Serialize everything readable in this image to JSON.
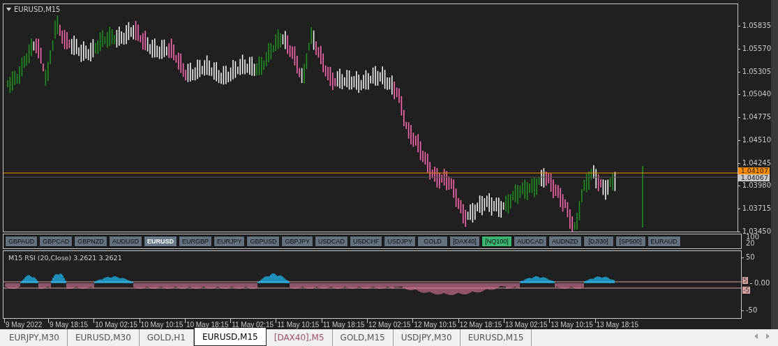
{
  "chart": {
    "title": "EURUSD,M15",
    "price_axis": [
      "1.05835",
      "1.05570",
      "1.05305",
      "1.05040",
      "1.04775",
      "1.04510",
      "1.04245",
      "1.03980",
      "1.03715",
      "1.03450"
    ],
    "bid_label": "1.04107",
    "ask_label": "1.04067"
  },
  "symbol_buttons": [
    {
      "label": "GBPAUD",
      "selected": false,
      "highlighted": false
    },
    {
      "label": "GBPCAD",
      "selected": false,
      "highlighted": false
    },
    {
      "label": "GBPNZD",
      "selected": false,
      "highlighted": false
    },
    {
      "label": "AUDUSD",
      "selected": false,
      "highlighted": false
    },
    {
      "label": "EURUSD",
      "selected": true,
      "highlighted": false
    },
    {
      "label": "EURGBP",
      "selected": false,
      "highlighted": false
    },
    {
      "label": "EURJPY",
      "selected": false,
      "highlighted": false
    },
    {
      "label": "GBPUSD",
      "selected": false,
      "highlighted": false
    },
    {
      "label": "GBPJPY",
      "selected": false,
      "highlighted": false
    },
    {
      "label": "USDCAD",
      "selected": false,
      "highlighted": false
    },
    {
      "label": "USDCHF",
      "selected": false,
      "highlighted": false
    },
    {
      "label": "USDJPY",
      "selected": false,
      "highlighted": false
    },
    {
      "label": "GOLD",
      "selected": false,
      "highlighted": false
    },
    {
      "label": "[DAX40]",
      "selected": false,
      "highlighted": false
    },
    {
      "label": "[NQ100]",
      "selected": false,
      "highlighted": true
    },
    {
      "label": "AUDCAD",
      "selected": false,
      "highlighted": false
    },
    {
      "label": "AUDNZD",
      "selected": false,
      "highlighted": false
    },
    {
      "label": "[DJI30]",
      "selected": false,
      "highlighted": false
    },
    {
      "label": "[SP500]",
      "selected": false,
      "highlighted": false
    },
    {
      "label": "EURAUD",
      "selected": false,
      "highlighted": false
    }
  ],
  "button_axis": [
    "100",
    "20"
  ],
  "rsi": {
    "title": "M15 RSI (20,Close) 3.2621 3.2621",
    "axis": [
      "50",
      "-50"
    ],
    "upper_level": "5",
    "zero_label": "0.00",
    "lower_level": "-5"
  },
  "time_axis": [
    "9 May 2022",
    "9 May 18:15",
    "10 May 02:15",
    "10 May 10:15",
    "10 May 18:15",
    "11 May 02:15",
    "11 May 10:15",
    "11 May 18:15",
    "12 May 02:15",
    "12 May 10:15",
    "12 May 18:15",
    "13 May 02:15",
    "13 May 10:15",
    "13 May 18:15"
  ],
  "tabs": [
    {
      "label": "EURJPY,M30",
      "selected": false,
      "color": "#555555"
    },
    {
      "label": "EURUSD,M30",
      "selected": false,
      "color": "#555555"
    },
    {
      "label": "GOLD,H1",
      "selected": false,
      "color": "#555555"
    },
    {
      "label": "EURUSD,M15",
      "selected": true,
      "color": "#000000"
    },
    {
      "label": "[DAX40],M5",
      "selected": false,
      "color": "#a0506e"
    },
    {
      "label": "GOLD,M15",
      "selected": false,
      "color": "#555555"
    },
    {
      "label": "USDJPY,M30",
      "selected": false,
      "color": "#555555"
    },
    {
      "label": "EURUSD,M15",
      "selected": false,
      "color": "#555555"
    }
  ]
}
